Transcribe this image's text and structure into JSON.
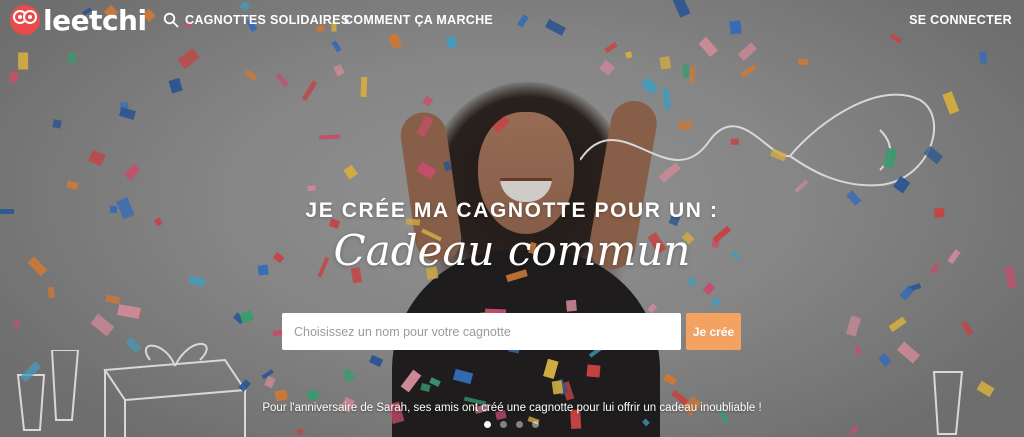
{
  "brand": {
    "name": "leetchi",
    "accent": "#e94b4b"
  },
  "nav": {
    "search_icon": "search-icon",
    "links": [
      "CAGNOTTES SOLIDAIRES",
      "COMMENT ÇA MARCHE"
    ],
    "login": "SE CONNECTER"
  },
  "hero": {
    "headline": "JE CRÉE MA CAGNOTTE POUR UN :",
    "occasion": "Cadeau commun",
    "input_placeholder": "Choisissez un nom pour votre cagnotte",
    "input_value": "",
    "cta_label": "Je crée",
    "cta_color": "#f4a261",
    "caption": "Pour l'anniversaire de Sarah, ses amis ont créé une cagnotte pour lui offrir un cadeau inoubliable !"
  },
  "carousel": {
    "slide_count": 4,
    "active_slide": 1
  }
}
